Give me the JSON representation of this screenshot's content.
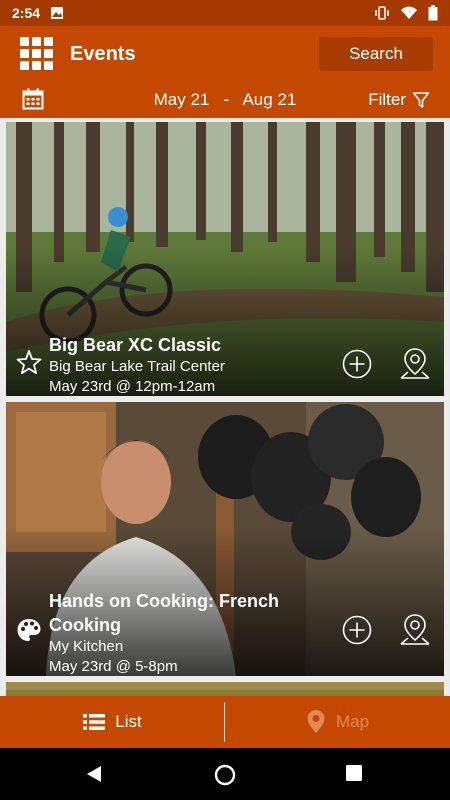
{
  "status_bar": {
    "time": "2:54"
  },
  "header": {
    "title": "Events",
    "search_label": "Search"
  },
  "date_bar": {
    "start": "May 21",
    "separator": "-",
    "end": "Aug 21",
    "filter_label": "Filter"
  },
  "events": [
    {
      "name": "Big Bear XC Classic",
      "venue": "Big Bear Lake Trail Center",
      "when": "May 23rd @ 12pm-12am",
      "category_icon": "star-icon"
    },
    {
      "name": "Hands on Cooking: French Cooking",
      "venue": "My Kitchen",
      "when": "May 23rd @ 5-8pm",
      "category_icon": "palette-icon"
    }
  ],
  "tabs": [
    {
      "label": "List",
      "icon": "list-icon",
      "active": true
    },
    {
      "label": "Map",
      "icon": "map-pin-icon",
      "active": false
    }
  ],
  "colors": {
    "brand": "#c44800",
    "brand_dark": "#a43a00",
    "inactive_tab": "#e08a5a"
  }
}
